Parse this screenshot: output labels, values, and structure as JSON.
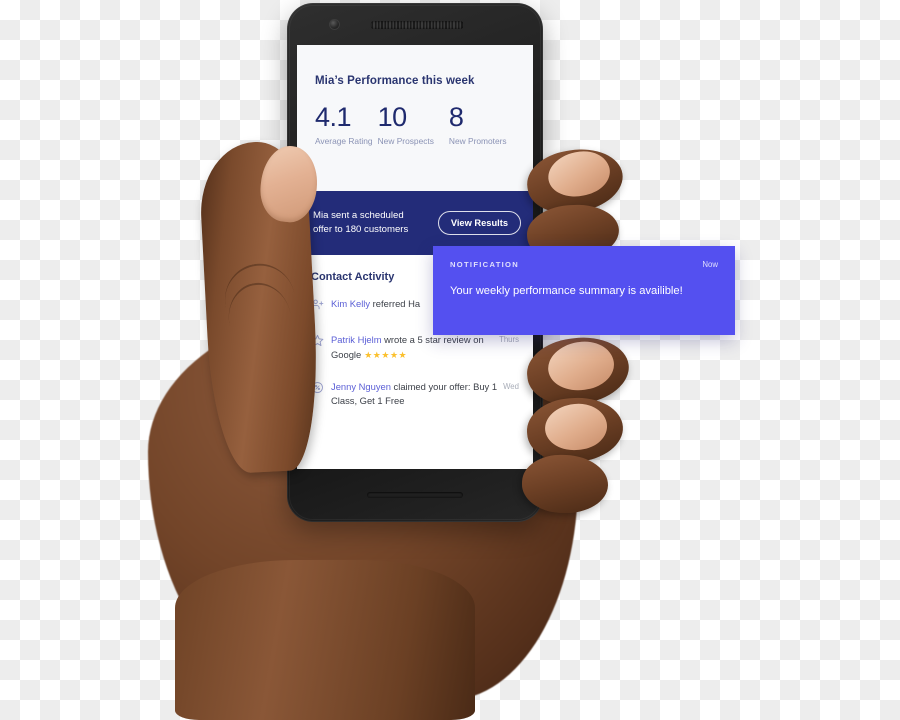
{
  "device": {
    "type": "smartphone-in-hand",
    "camera_icon": "front-camera-icon",
    "earpiece_icon": "earpiece-speaker-icon",
    "speaker_icon": "bottom-speaker-icon"
  },
  "screen": {
    "performance_card": {
      "title": "Mia’s Performance this week",
      "stats": [
        {
          "value": "4.1",
          "label": "Average Rating"
        },
        {
          "value": "10",
          "label": "New Prospects"
        },
        {
          "value": "8",
          "label": "New Promoters"
        }
      ]
    },
    "offer_banner": {
      "line1": "Mia sent a scheduled",
      "line2": "offer to 180 customers",
      "button_label": "View Results"
    },
    "activity": {
      "title": "Contact Activity",
      "items": [
        {
          "icon": "person-add-icon",
          "actor": "Kim Kelly",
          "text": " referred Ha",
          "time": "",
          "stars": ""
        },
        {
          "icon": "star-outline-icon",
          "actor": "Patrik Hjelm",
          "text": " wrote a 5 star review on Google",
          "time": "Thurs",
          "stars": "★★★★★"
        },
        {
          "icon": "offer-tag-icon",
          "actor": "Jenny Nguyen",
          "text": " claimed your offer: Buy 1 Class, Get 1 Free",
          "time": "Wed",
          "stars": ""
        }
      ]
    }
  },
  "notification": {
    "kicker": "NOTIFICATION",
    "time": "Now",
    "message": "Your weekly performance summary is availible!"
  },
  "colors": {
    "navy": "#232c79",
    "indigo_accent": "#5450f0",
    "link": "#5b5fd6",
    "star_gold": "#fbc02d",
    "card_bg": "#f7f8fa",
    "muted_label": "#8b93b5"
  }
}
